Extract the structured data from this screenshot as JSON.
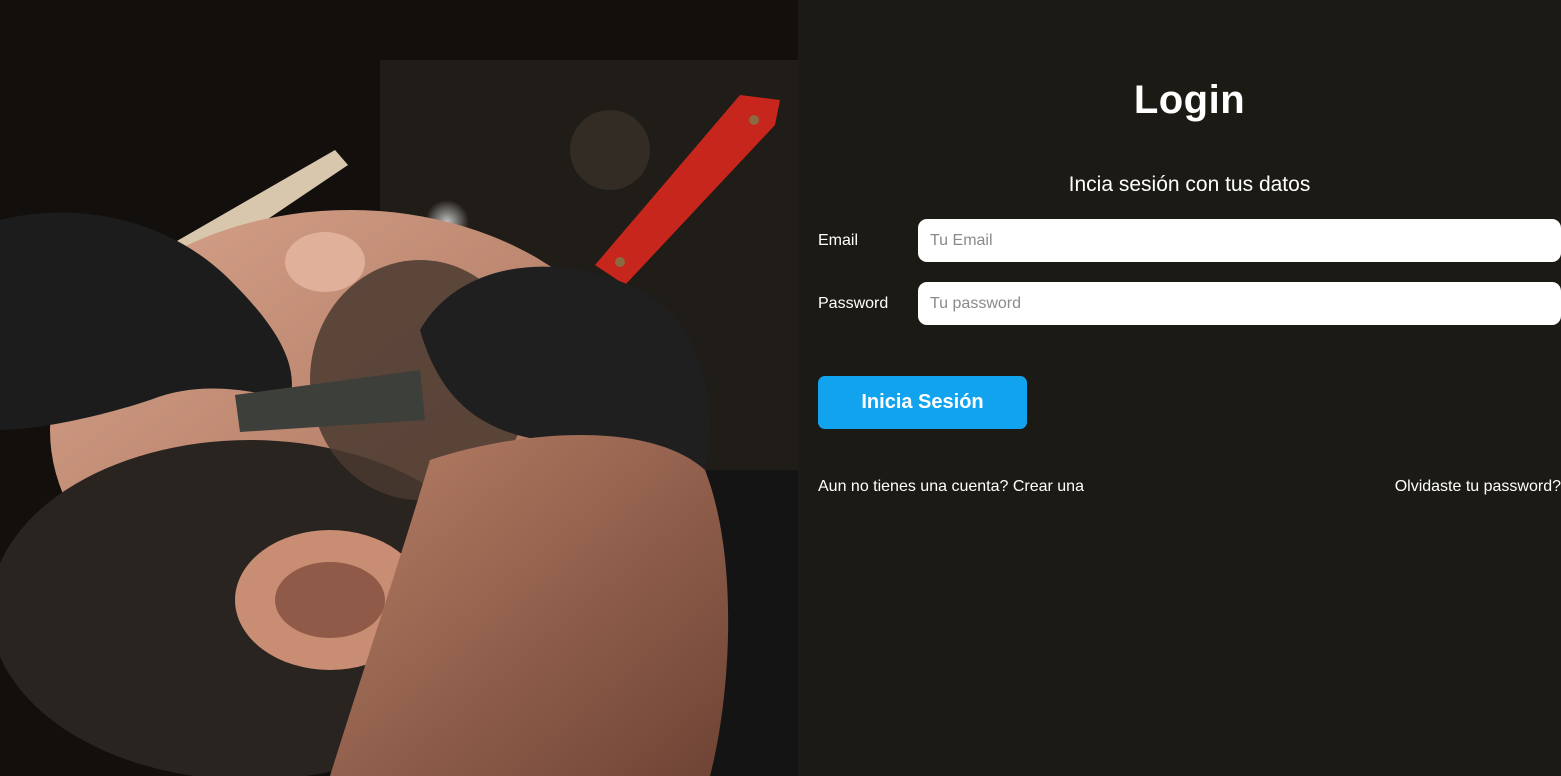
{
  "hero": {
    "image_description": "barber-shave-photo"
  },
  "login": {
    "title": "Login",
    "subtitle": "Incia sesión con tus datos",
    "email_label": "Email",
    "email_placeholder": "Tu Email",
    "email_value": "",
    "password_label": "Password",
    "password_placeholder": "Tu password",
    "password_value": "",
    "submit_label": "Inicia Sesión",
    "create_account_link": "Aun no tienes una cuenta? Crear una",
    "forgot_password_link": "Olvidaste tu password?"
  },
  "colors": {
    "panel_bg": "#1b1a14",
    "accent": "#12a3ee",
    "text": "#ffffff"
  }
}
